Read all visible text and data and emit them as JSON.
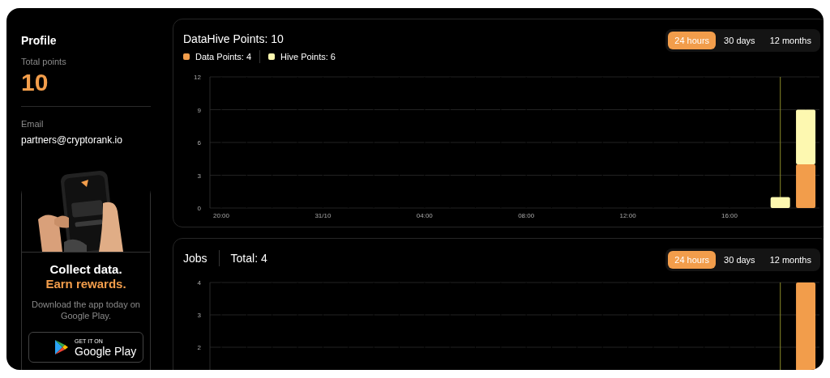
{
  "profile": {
    "title": "Profile",
    "total_label": "Total points",
    "total_value": "10",
    "email_label": "Email",
    "email": "partners@cryptorank.io"
  },
  "promo": {
    "headline": "Collect data.",
    "headline_accent": "Earn rewards.",
    "text": "Download the app today on Google Play.",
    "store_small": "GET IT ON",
    "store_big": "Google Play"
  },
  "panels": [
    {
      "title": "DataHive Points: 10",
      "legend": [
        {
          "label": "Data Points: 4",
          "color": "#f29d4b"
        },
        {
          "label": "Hive Points: 6",
          "color": "#fdf8b0"
        }
      ],
      "ranges": [
        {
          "label": "24 hours",
          "selected": true
        },
        {
          "label": "30 days",
          "selected": false
        },
        {
          "label": "12 months",
          "selected": false
        }
      ],
      "cursor_at": [
        false,
        false,
        false,
        false,
        false,
        false,
        false,
        false,
        false,
        false,
        false,
        false,
        false,
        false,
        false,
        false,
        false,
        false,
        false,
        false,
        false,
        false,
        true,
        false
      ],
      "chart_data": {
        "type": "bar",
        "stacked": true,
        "grid": true,
        "categories": [
          "20:00",
          null,
          null,
          null,
          "31/10",
          null,
          null,
          null,
          "04:00",
          null,
          null,
          null,
          "08:00",
          null,
          null,
          null,
          "12:00",
          null,
          null,
          null,
          "16:00",
          null,
          null,
          null
        ],
        "ylim": [
          0,
          12
        ],
        "yticks": [
          0,
          3,
          6,
          9,
          12
        ],
        "series": [
          {
            "color": "#f29d4b",
            "values": [
              0,
              0,
              0,
              0,
              0,
              0,
              0,
              0,
              0,
              0,
              0,
              0,
              0,
              0,
              0,
              0,
              0,
              0,
              0,
              0,
              0,
              0,
              0,
              4
            ]
          },
          {
            "color": "#fdf8b0",
            "values": [
              0,
              0,
              0,
              0,
              0,
              0,
              0,
              0,
              0,
              0,
              0,
              0,
              0,
              0,
              0,
              0,
              0,
              0,
              0,
              0,
              0,
              0,
              1,
              5
            ]
          }
        ]
      }
    },
    {
      "title": "Jobs",
      "total": "Total: 4",
      "ranges": [
        {
          "label": "24 hours",
          "selected": true
        },
        {
          "label": "30 days",
          "selected": false
        },
        {
          "label": "12 months",
          "selected": false
        }
      ],
      "cursor_at": [
        false,
        false,
        false,
        false,
        false,
        false,
        false,
        false,
        false,
        false,
        false,
        false,
        false,
        false,
        false,
        false,
        false,
        false,
        false,
        false,
        false,
        false,
        true,
        false
      ],
      "chart_data": {
        "type": "bar",
        "stacked": true,
        "grid": true,
        "categories": [
          null,
          null,
          null,
          null,
          null,
          null,
          null,
          null,
          null,
          null,
          null,
          null,
          null,
          null,
          null,
          null,
          null,
          null,
          null,
          null,
          null,
          null,
          null,
          null
        ],
        "ylim": [
          0,
          4
        ],
        "yticks": [
          2,
          3,
          4
        ],
        "series": [
          {
            "color": "#f29d4b",
            "values": [
              0,
              0,
              0,
              0,
              0,
              0,
              0,
              0,
              0,
              0,
              0,
              0,
              0,
              0,
              0,
              0,
              0,
              0,
              0,
              0,
              0,
              0,
              0,
              4
            ]
          }
        ]
      }
    }
  ]
}
